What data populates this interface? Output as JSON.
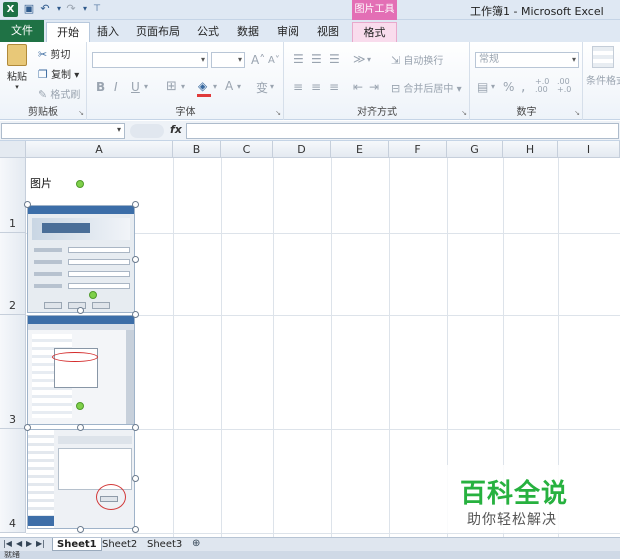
{
  "window": {
    "title": "工作簿1 - Microsoft Excel",
    "context_group": "图片工具",
    "app_icon": "X"
  },
  "quick_access": {
    "save_icon": "save-icon",
    "undo_icon": "undo-icon",
    "redo_icon": "redo-icon",
    "customize_icon": "customize-icon"
  },
  "tabs": [
    {
      "label": "文件"
    },
    {
      "label": "开始"
    },
    {
      "label": "插入"
    },
    {
      "label": "页面布局"
    },
    {
      "label": "公式"
    },
    {
      "label": "数据"
    },
    {
      "label": "审阅"
    },
    {
      "label": "视图"
    },
    {
      "label": "格式"
    }
  ],
  "ribbon": {
    "clipboard": {
      "label": "剪贴板",
      "paste": "粘贴",
      "cut": "剪切",
      "copy": "复制",
      "format_painter": "格式刷"
    },
    "font": {
      "label": "字体",
      "bold": "B",
      "italic": "I",
      "underline": "U",
      "grow": "A",
      "shrink": "A",
      "color": "A",
      "phonetic": "变"
    },
    "alignment": {
      "label": "对齐方式",
      "wrap": "自动换行",
      "merge": "合并后居中"
    },
    "number": {
      "label": "数字",
      "format": "常规",
      "percent": "%",
      "comma": ",",
      "inc_decimal": "+.0 .00",
      "dec_decimal": ".00 +.0"
    },
    "styles": {
      "cond_format": "条件格式"
    }
  },
  "formula_bar": {
    "name_box": "",
    "fx": "fx",
    "value": ""
  },
  "sheet": {
    "columns": [
      "A",
      "B",
      "C",
      "D",
      "E",
      "F",
      "G",
      "H",
      "I"
    ],
    "rows": [
      "1",
      "2",
      "3",
      "4"
    ],
    "cell_a1": "图片"
  },
  "sheet_tabs": [
    "Sheet1",
    "Sheet2",
    "Sheet3"
  ],
  "status": {
    "mode": "就绪"
  },
  "watermark": {
    "title": "百科全说",
    "subtitle": "助你轻松解决"
  },
  "colors": {
    "excel_green": "#1f7245",
    "context_pink": "#e36fb5",
    "watermark_green": "#27b13f"
  }
}
